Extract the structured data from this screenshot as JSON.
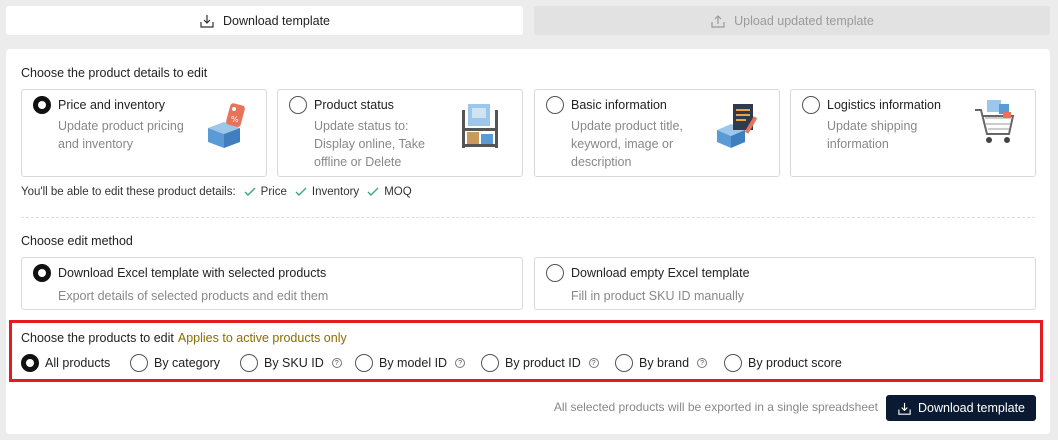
{
  "tabs": {
    "download_label": "Download template",
    "upload_label": "Upload updated template"
  },
  "details": {
    "title": "Choose the product details to edit",
    "cards": [
      {
        "title": "Price and inventory",
        "desc": [
          "Update product pricing",
          "and inventory"
        ],
        "selected": true,
        "icon": "price-tag-box-icon"
      },
      {
        "title": "Product status",
        "desc": [
          "Update status to:",
          "Display online, Take",
          "offline or Delete"
        ],
        "selected": false,
        "icon": "shelf-boxes-icon"
      },
      {
        "title": "Basic information",
        "desc": [
          "Update product title,",
          "keyword, image or",
          "description"
        ],
        "selected": false,
        "icon": "document-box-icon"
      },
      {
        "title": "Logistics information",
        "desc": [
          "Update shipping",
          "information"
        ],
        "selected": false,
        "icon": "shopping-cart-icon"
      }
    ],
    "editable_label": "You'll be able to edit these product details:",
    "editable_items": [
      "Price",
      "Inventory",
      "MOQ"
    ]
  },
  "method": {
    "title": "Choose edit method",
    "options": [
      {
        "title": "Download Excel template with selected products",
        "desc": "Export details of selected products and edit them",
        "selected": true
      },
      {
        "title": "Download empty Excel template",
        "desc": "Fill in product SKU ID manually",
        "selected": false
      }
    ]
  },
  "products": {
    "title": "Choose the products to edit",
    "note": "Applies to active products only",
    "options": [
      {
        "label": "All products",
        "selected": true,
        "help": false
      },
      {
        "label": "By category",
        "selected": false,
        "help": false
      },
      {
        "label": "By SKU ID",
        "selected": false,
        "help": true
      },
      {
        "label": "By model ID",
        "selected": false,
        "help": true
      },
      {
        "label": "By product ID",
        "selected": false,
        "help": true
      },
      {
        "label": "By brand",
        "selected": false,
        "help": true
      },
      {
        "label": "By product score",
        "selected": false,
        "help": false
      }
    ],
    "help_glyph": "?"
  },
  "footer": {
    "note": "All selected products will be exported in a single spreadsheet",
    "button_label": "Download template"
  },
  "colors": {
    "primary": "#0b1a33",
    "highlight": "#e31c23",
    "check": "#3aa87a",
    "note": "#8a6d00"
  }
}
